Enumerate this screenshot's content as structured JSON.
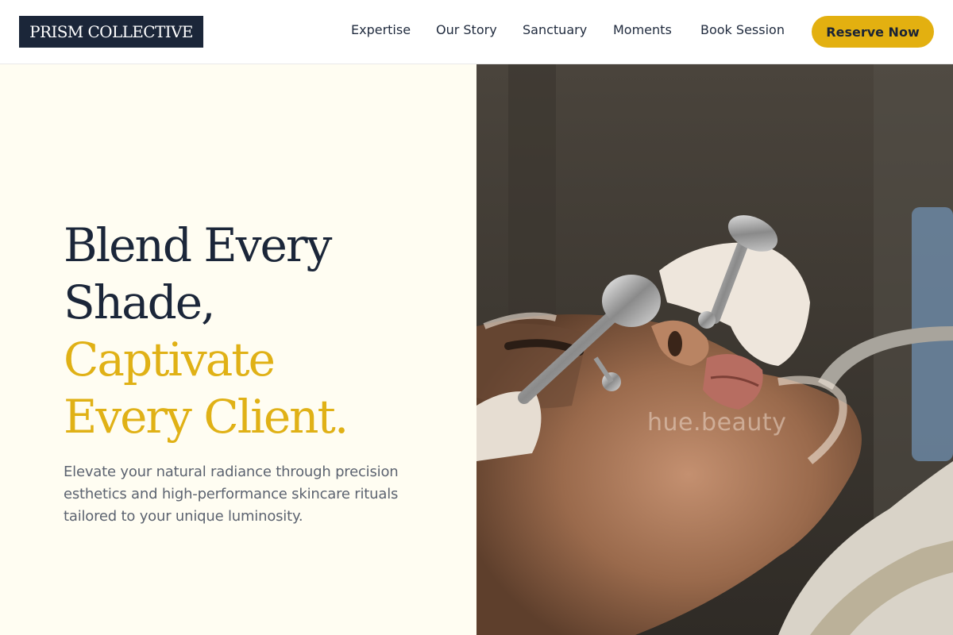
{
  "brand": {
    "logo_text": "PRISM COLLECTIVE"
  },
  "nav": {
    "items": [
      "Expertise",
      "Our Story",
      "Sanctuary",
      "Moments",
      "Book Session"
    ],
    "cta_label": "Reserve Now"
  },
  "hero": {
    "headline_lines": [
      "Blend Every",
      "Shade,",
      "Captivate",
      "Every Client."
    ],
    "description": "Elevate your natural radiance through precision esthetics and high-performance skincare rituals tailored to your unique luminosity.",
    "image_watermark": "hue.beauty"
  },
  "colors": {
    "brand_navy": "#1b2639",
    "accent_gold": "#e3b010",
    "background_cream": "#fffdf2"
  }
}
